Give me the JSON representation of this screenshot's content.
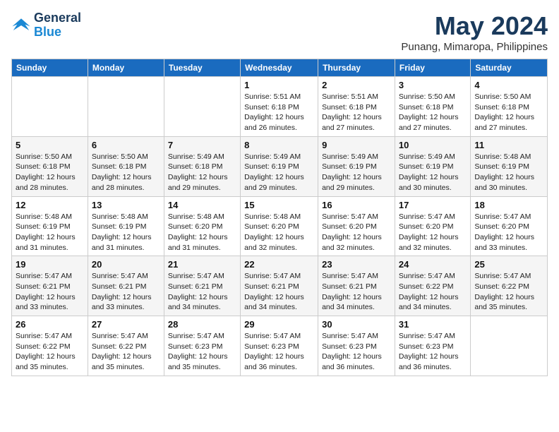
{
  "header": {
    "logo_line1": "General",
    "logo_line2": "Blue",
    "month_year": "May 2024",
    "location": "Punang, Mimaropa, Philippines"
  },
  "weekdays": [
    "Sunday",
    "Monday",
    "Tuesday",
    "Wednesday",
    "Thursday",
    "Friday",
    "Saturday"
  ],
  "weeks": [
    [
      {
        "day": "",
        "info": ""
      },
      {
        "day": "",
        "info": ""
      },
      {
        "day": "",
        "info": ""
      },
      {
        "day": "1",
        "info": "Sunrise: 5:51 AM\nSunset: 6:18 PM\nDaylight: 12 hours and 26 minutes."
      },
      {
        "day": "2",
        "info": "Sunrise: 5:51 AM\nSunset: 6:18 PM\nDaylight: 12 hours and 27 minutes."
      },
      {
        "day": "3",
        "info": "Sunrise: 5:50 AM\nSunset: 6:18 PM\nDaylight: 12 hours and 27 minutes."
      },
      {
        "day": "4",
        "info": "Sunrise: 5:50 AM\nSunset: 6:18 PM\nDaylight: 12 hours and 27 minutes."
      }
    ],
    [
      {
        "day": "5",
        "info": "Sunrise: 5:50 AM\nSunset: 6:18 PM\nDaylight: 12 hours and 28 minutes."
      },
      {
        "day": "6",
        "info": "Sunrise: 5:50 AM\nSunset: 6:18 PM\nDaylight: 12 hours and 28 minutes."
      },
      {
        "day": "7",
        "info": "Sunrise: 5:49 AM\nSunset: 6:18 PM\nDaylight: 12 hours and 29 minutes."
      },
      {
        "day": "8",
        "info": "Sunrise: 5:49 AM\nSunset: 6:19 PM\nDaylight: 12 hours and 29 minutes."
      },
      {
        "day": "9",
        "info": "Sunrise: 5:49 AM\nSunset: 6:19 PM\nDaylight: 12 hours and 29 minutes."
      },
      {
        "day": "10",
        "info": "Sunrise: 5:49 AM\nSunset: 6:19 PM\nDaylight: 12 hours and 30 minutes."
      },
      {
        "day": "11",
        "info": "Sunrise: 5:48 AM\nSunset: 6:19 PM\nDaylight: 12 hours and 30 minutes."
      }
    ],
    [
      {
        "day": "12",
        "info": "Sunrise: 5:48 AM\nSunset: 6:19 PM\nDaylight: 12 hours and 31 minutes."
      },
      {
        "day": "13",
        "info": "Sunrise: 5:48 AM\nSunset: 6:19 PM\nDaylight: 12 hours and 31 minutes."
      },
      {
        "day": "14",
        "info": "Sunrise: 5:48 AM\nSunset: 6:20 PM\nDaylight: 12 hours and 31 minutes."
      },
      {
        "day": "15",
        "info": "Sunrise: 5:48 AM\nSunset: 6:20 PM\nDaylight: 12 hours and 32 minutes."
      },
      {
        "day": "16",
        "info": "Sunrise: 5:47 AM\nSunset: 6:20 PM\nDaylight: 12 hours and 32 minutes."
      },
      {
        "day": "17",
        "info": "Sunrise: 5:47 AM\nSunset: 6:20 PM\nDaylight: 12 hours and 32 minutes."
      },
      {
        "day": "18",
        "info": "Sunrise: 5:47 AM\nSunset: 6:20 PM\nDaylight: 12 hours and 33 minutes."
      }
    ],
    [
      {
        "day": "19",
        "info": "Sunrise: 5:47 AM\nSunset: 6:21 PM\nDaylight: 12 hours and 33 minutes."
      },
      {
        "day": "20",
        "info": "Sunrise: 5:47 AM\nSunset: 6:21 PM\nDaylight: 12 hours and 33 minutes."
      },
      {
        "day": "21",
        "info": "Sunrise: 5:47 AM\nSunset: 6:21 PM\nDaylight: 12 hours and 34 minutes."
      },
      {
        "day": "22",
        "info": "Sunrise: 5:47 AM\nSunset: 6:21 PM\nDaylight: 12 hours and 34 minutes."
      },
      {
        "day": "23",
        "info": "Sunrise: 5:47 AM\nSunset: 6:21 PM\nDaylight: 12 hours and 34 minutes."
      },
      {
        "day": "24",
        "info": "Sunrise: 5:47 AM\nSunset: 6:22 PM\nDaylight: 12 hours and 34 minutes."
      },
      {
        "day": "25",
        "info": "Sunrise: 5:47 AM\nSunset: 6:22 PM\nDaylight: 12 hours and 35 minutes."
      }
    ],
    [
      {
        "day": "26",
        "info": "Sunrise: 5:47 AM\nSunset: 6:22 PM\nDaylight: 12 hours and 35 minutes."
      },
      {
        "day": "27",
        "info": "Sunrise: 5:47 AM\nSunset: 6:22 PM\nDaylight: 12 hours and 35 minutes."
      },
      {
        "day": "28",
        "info": "Sunrise: 5:47 AM\nSunset: 6:23 PM\nDaylight: 12 hours and 35 minutes."
      },
      {
        "day": "29",
        "info": "Sunrise: 5:47 AM\nSunset: 6:23 PM\nDaylight: 12 hours and 36 minutes."
      },
      {
        "day": "30",
        "info": "Sunrise: 5:47 AM\nSunset: 6:23 PM\nDaylight: 12 hours and 36 minutes."
      },
      {
        "day": "31",
        "info": "Sunrise: 5:47 AM\nSunset: 6:23 PM\nDaylight: 12 hours and 36 minutes."
      },
      {
        "day": "",
        "info": ""
      }
    ]
  ]
}
